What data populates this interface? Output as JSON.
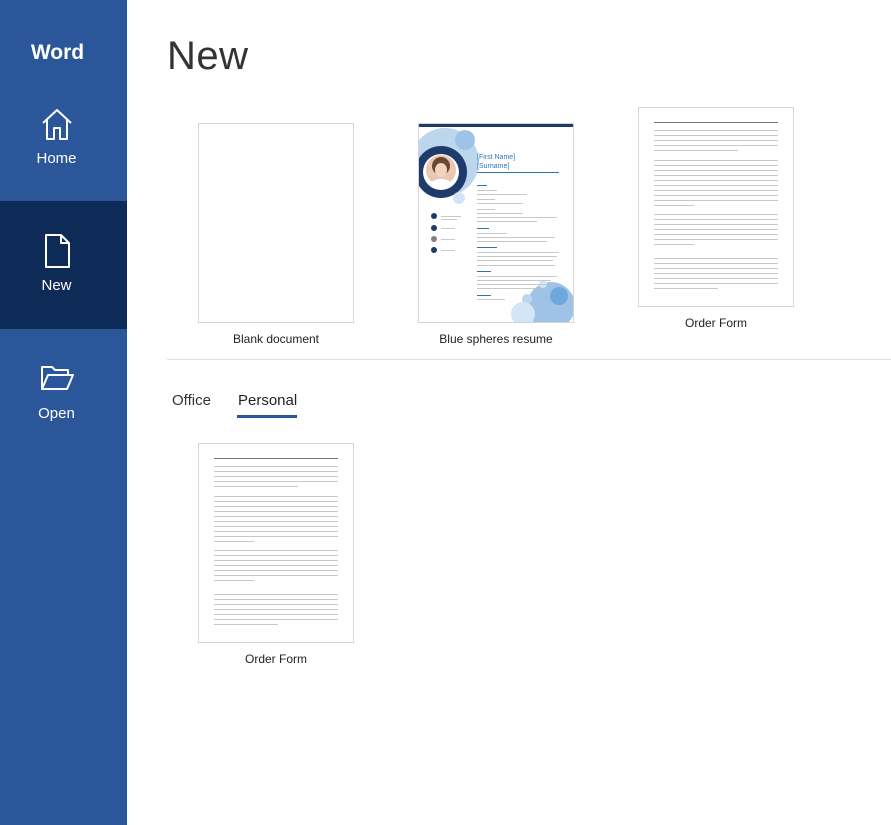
{
  "app": {
    "title": "Word"
  },
  "sidebar": {
    "items": [
      {
        "label": "Home",
        "icon": "home-icon"
      },
      {
        "label": "New",
        "icon": "new-document-icon",
        "selected": true
      },
      {
        "label": "Open",
        "icon": "open-folder-icon"
      }
    ]
  },
  "main": {
    "title": "New",
    "featured_templates": [
      {
        "label": "Blank document"
      },
      {
        "label": "Blue spheres resume",
        "preview_name": "[First Name]",
        "preview_surname": "[Surname]"
      },
      {
        "label": "Order Form"
      }
    ],
    "tabs": [
      {
        "label": "Office",
        "active": false
      },
      {
        "label": "Personal",
        "active": true
      }
    ],
    "personal_templates": [
      {
        "label": "Order Form"
      }
    ]
  },
  "colors": {
    "sidebar_bg": "#2b579a",
    "sidebar_selected_bg": "#0e2a57",
    "accent": "#2b579a"
  }
}
